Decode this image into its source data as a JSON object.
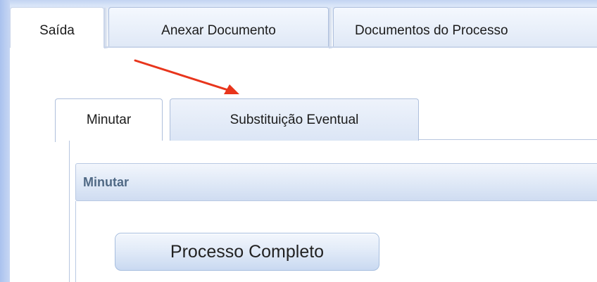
{
  "top_tabs": [
    {
      "label": "Saída",
      "active": true
    },
    {
      "label": "Anexar Documento",
      "active": false
    },
    {
      "label": "Documentos do Processo",
      "active": false
    }
  ],
  "inner_tabs": [
    {
      "label": "Minutar",
      "active": true
    },
    {
      "label": "Substituição Eventual",
      "active": false
    }
  ],
  "section": {
    "title": "Minutar"
  },
  "actions": {
    "processo_completo_label": "Processo Completo"
  },
  "colors": {
    "annotation_arrow": "#e8351c",
    "accent": "#506985"
  }
}
